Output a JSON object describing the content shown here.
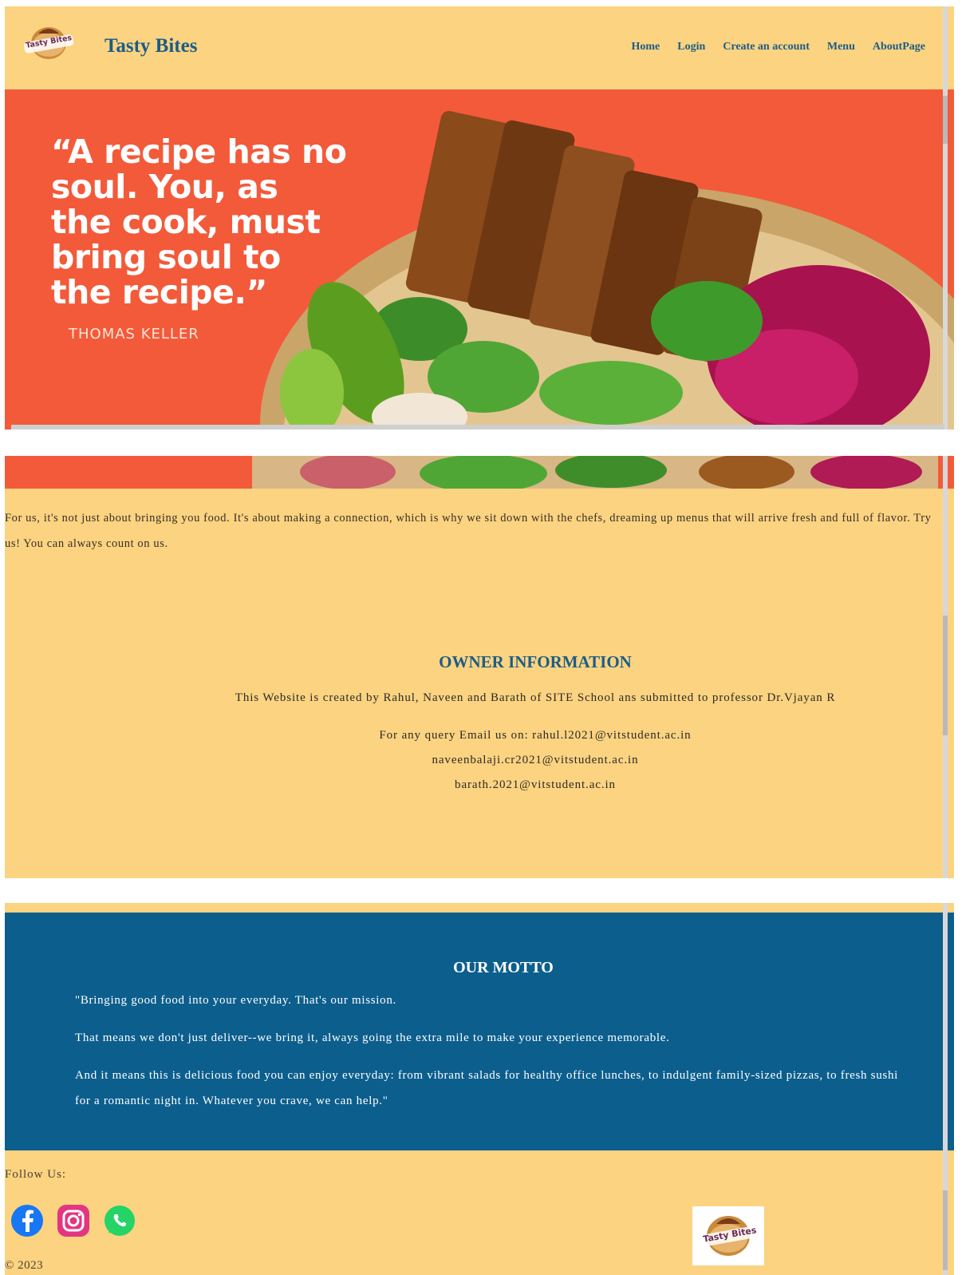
{
  "brand": {
    "name": "Tasty Bites",
    "logo_text": "Tasty Bites"
  },
  "nav": {
    "items": [
      "Home",
      "Login",
      "Create an account",
      "Menu",
      "AboutPage"
    ]
  },
  "hero": {
    "quote": "“A recipe has no\nsoul. You, as\nthe cook, must\nbring soul to\nthe recipe.”",
    "author": "THOMAS KELLER"
  },
  "intro": "For us, it's not just about bringing you food. It's about making a connection, which is why we sit down with the chefs, dreaming up menus that will arrive fresh and full of flavor. Try us! You can always count on us.",
  "owner": {
    "title": "OWNER INFORMATION",
    "created_by": "This Website is created by Rahul, Naveen and Barath of SITE School ans submitted to professor Dr.Vjayan R",
    "query_line": "For any query Email us on: rahul.l2021@vitstudent.ac.in",
    "email_2": "naveenbalaji.cr2021@vitstudent.ac.in",
    "email_3": "barath.2021@vitstudent.ac.in"
  },
  "motto": {
    "title": "OUR MOTTO",
    "p1": "\"Bringing good food into your everyday. That's our mission.",
    "p2": "That means we don't just deliver--we bring it, always going the extra mile to make your experience memorable.",
    "p3": "And it means this is delicious food you can enjoy everyday: from vibrant salads for healthy office lunches, to indulgent family-sized pizzas, to fresh sushi for a romantic night in. Whatever you crave, we can help.\""
  },
  "footer": {
    "follow_label": "Follow Us:",
    "social_icons": [
      "facebook-icon",
      "instagram-icon",
      "whatsapp-icon"
    ],
    "copyright": "© 2023"
  },
  "colors": {
    "cream": "#fbd381",
    "brand_blue": "#1c5d86",
    "hero_red": "#f35a3a",
    "motto_blue": "#0c5e8d"
  }
}
